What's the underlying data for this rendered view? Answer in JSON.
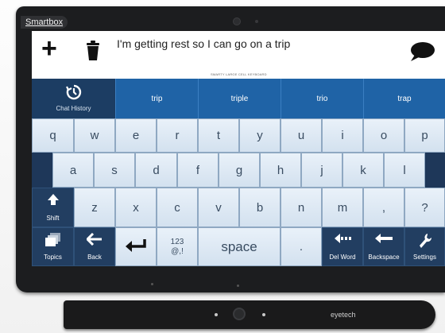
{
  "device": {
    "badge_brand": "Smartbox",
    "eyetracker_brand": "eyetech"
  },
  "message_bar": {
    "text": "I'm getting rest so I can go on a  trip",
    "caption": "SMARTY LARGE CELL KEYBOARD",
    "new_icon": "plus-icon",
    "clear_icon": "trash-icon",
    "speak_icon": "speech-bubble-icon"
  },
  "predictions": {
    "chat_history_label": "Chat History",
    "chat_history_icon": "history-icon",
    "words": [
      "trip",
      "triple",
      "trio",
      "trap"
    ]
  },
  "keyboard": {
    "row1": [
      "q",
      "w",
      "e",
      "r",
      "t",
      "y",
      "u",
      "i",
      "o",
      "p"
    ],
    "row2": [
      "a",
      "s",
      "d",
      "f",
      "g",
      "h",
      "j",
      "k",
      "l"
    ],
    "row3": [
      "z",
      "x",
      "c",
      "v",
      "b",
      "n",
      "m",
      ",",
      "?"
    ],
    "shift_label": "Shift",
    "numbers_label_top": "123",
    "numbers_label_bottom": "@,!",
    "space_label": "space",
    "period_label": ".",
    "topics_label": "Topics",
    "back_label": "Back",
    "del_word_label": "Del Word",
    "backspace_label": "Backspace",
    "settings_label": "Settings"
  },
  "colors": {
    "bezel": "#1c1d1f",
    "prediction_bg": "#1f63a6",
    "function_key_bg": "#223e61",
    "letter_key_bg": "#dde8f3"
  }
}
